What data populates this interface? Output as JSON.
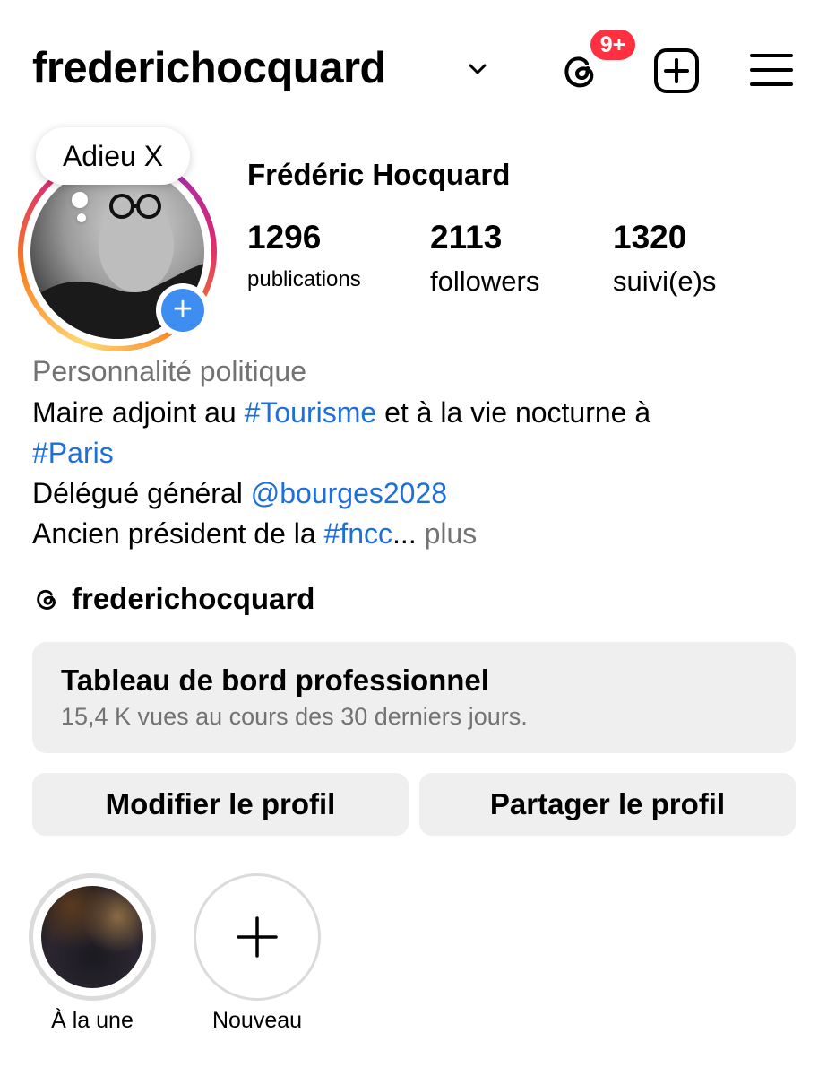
{
  "header": {
    "username": "frederichocquard",
    "notification_badge": "9+"
  },
  "profile": {
    "note": "Adieu X",
    "full_name": "Frédéric Hocquard",
    "stats": [
      {
        "value": "1296",
        "label": "publications"
      },
      {
        "value": "2113",
        "label": "followers"
      },
      {
        "value": "1320",
        "label": "suivi(e)s"
      }
    ],
    "category": "Personnalité politique",
    "bio": {
      "line1_text": "Maire adjoint au ",
      "line1_tag": "#Tourisme",
      "line1_rest": " et à la vie nocturne à",
      "line2_tag": "#Paris",
      "line3_text": "Délégué général ",
      "line3_mention": "@bourges2028",
      "line4_text": "Ancien président de la ",
      "line4_tag": "#fncc",
      "line4_ellipsis": "...",
      "more": " plus"
    },
    "threads_handle": "frederichocquard"
  },
  "dashboard": {
    "title": "Tableau de bord professionnel",
    "subtitle": "15,4 K vues au cours des 30 derniers jours."
  },
  "buttons": {
    "edit": "Modifier le profil",
    "share": "Partager le profil"
  },
  "highlights": [
    {
      "label": "À la une"
    },
    {
      "label": "Nouveau"
    }
  ],
  "colors": {
    "badge": "#ff3040",
    "link": "#1e6fd9",
    "add_blue": "#3d8ef0"
  }
}
